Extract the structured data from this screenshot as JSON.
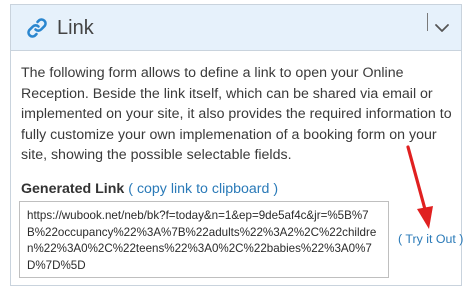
{
  "panel": {
    "title": "Link",
    "icon": "link-icon",
    "collapse_icon": "chevron-down-icon",
    "header_bg": "#e6f1fb"
  },
  "description": "The following form allows to define a link to open your Online Reception. Beside the link itself, which can be shared via email or implemented on your site, it also provides the required information to fully customize your own implemenation of a booking form on your site, showing the possible selectable fields.",
  "generated_link": {
    "label": "Generated Link",
    "paren_open": "(",
    "copy_label": "copy link to clipboard",
    "paren_close": ")",
    "value": "https://wubook.net/neb/bk?f=today&n=1&ep=9de5af4c&jr=%5B%7B%22occupancy%22%3A%7B%22adults%22%3A2%2C%22children%22%3A0%2C%22teens%22%3A0%2C%22babies%22%3A0%7D%7D%5D"
  },
  "try_it": {
    "paren_open": "(",
    "label": "Try it Out",
    "paren_close": ")"
  },
  "colors": {
    "accent": "#2a7ab8",
    "arrow": "#e02020",
    "border": "#c9d3dd"
  }
}
